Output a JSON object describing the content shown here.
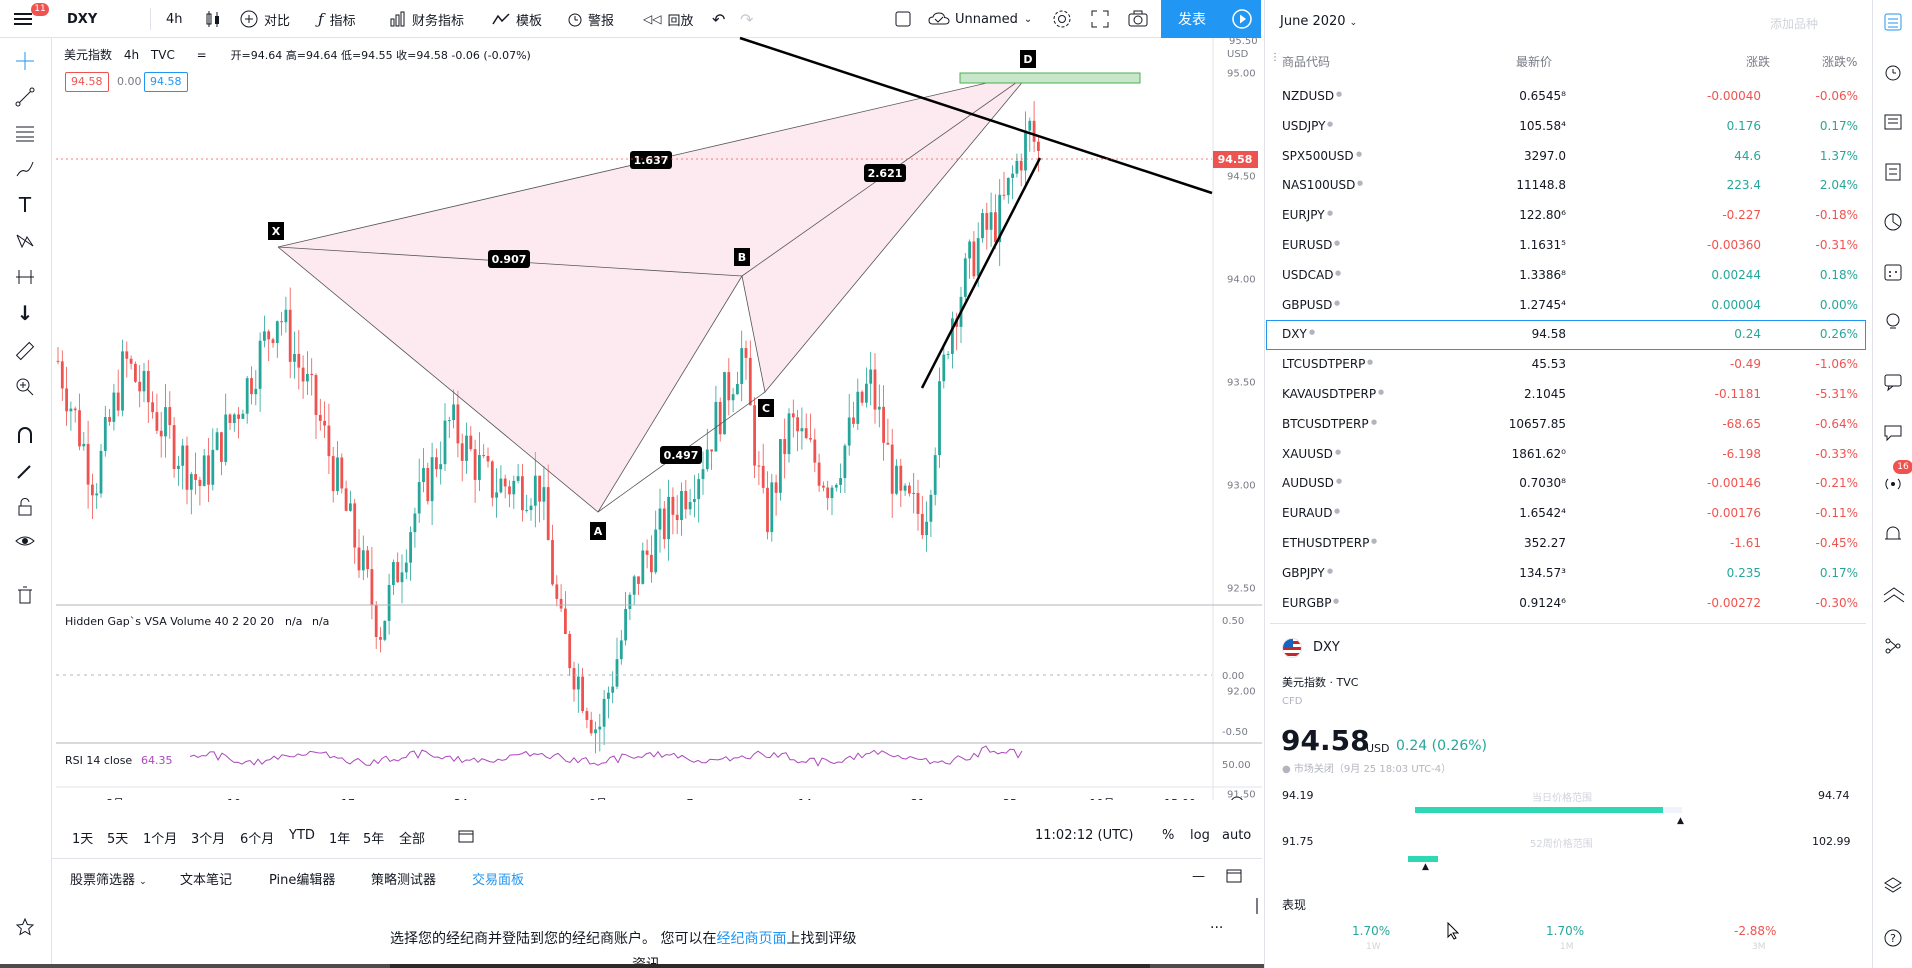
{
  "toolbar": {
    "menu_badge": "11",
    "symbol": "DXY",
    "interval": "4h",
    "compare": "对比",
    "indicators": "指标",
    "financials": "财务指标",
    "templates": "模板",
    "alerts": "警报",
    "replay": "回放",
    "layout_name": "Unnamed",
    "publish": "发表"
  },
  "legend": {
    "name": "美元指数",
    "interval": "4h",
    "exchange": "TVC",
    "ohlc": "开=94.64 高=94.64 低=94.55 收=94.58 -0.06 (-0.07%)",
    "bid": "94.58",
    "spread": "0.00",
    "ask": "94.58"
  },
  "price_axis": {
    "currency": "USD",
    "ticks": [
      "95.00",
      "94.50",
      "94.00",
      "93.50",
      "93.00",
      "92.50",
      "92.00",
      "91.50"
    ],
    "current_price": "94.58",
    "top_partial": "95.50"
  },
  "pattern": {
    "points": [
      "X",
      "A",
      "B",
      "C",
      "D"
    ],
    "ratios": {
      "xd": "1.637",
      "bd": "2.621",
      "xb": "0.907",
      "ac": "0.497"
    }
  },
  "vsa_pane": {
    "label": "Hidden Gap`s VSA Volume 40 2 20 20",
    "val1": "n/a",
    "val2": "n/a",
    "ticks": [
      "0.50",
      "0.00",
      "-0.50"
    ]
  },
  "rsi_pane": {
    "label": "RSI 14 close",
    "value": "64.35",
    "tick": "50.00",
    "color": "#ab47bc"
  },
  "time_axis": {
    "labels": [
      "8月",
      "10",
      "17",
      "24",
      "9月",
      "7",
      "14",
      "21",
      "25",
      "10月",
      "15:00"
    ]
  },
  "range_bar": {
    "ranges": [
      "1天",
      "5天",
      "1个月",
      "3个月",
      "6个月",
      "YTD",
      "1年",
      "5年",
      "全部"
    ],
    "clock": "11:02:12 (UTC)",
    "percent": "%",
    "log": "log",
    "auto": "auto"
  },
  "bottom_tabs": [
    "股票筛选器",
    "文本笔记",
    "Pine编辑器",
    "策略测试器",
    "交易面板"
  ],
  "broker_msg": {
    "before": "选择您的经纪商并登陆到您的经纪商账户。 您可以在",
    "link": "经纪商页面",
    "after": "上找到评级",
    "line2": "资讯"
  },
  "watchlist": {
    "title": "June 2020",
    "add": "添加品种",
    "headers": [
      "商品代码",
      "最新价",
      "涨跌",
      "涨跌%"
    ],
    "rows": [
      {
        "sym": "NZDUSD",
        "last": "0.6545⁸",
        "chg": "-0.00040",
        "pct": "-0.06%",
        "dir": "neg"
      },
      {
        "sym": "USDJPY",
        "last": "105.58⁴",
        "chg": "0.176",
        "pct": "0.17%",
        "dir": "pos"
      },
      {
        "sym": "SPX500USD",
        "last": "3297.0",
        "chg": "44.6",
        "pct": "1.37%",
        "dir": "pos"
      },
      {
        "sym": "NAS100USD",
        "last": "11148.8",
        "chg": "223.4",
        "pct": "2.04%",
        "dir": "pos"
      },
      {
        "sym": "EURJPY",
        "last": "122.80⁶",
        "chg": "-0.227",
        "pct": "-0.18%",
        "dir": "neg"
      },
      {
        "sym": "EURUSD",
        "last": "1.1631⁵",
        "chg": "-0.00360",
        "pct": "-0.31%",
        "dir": "neg"
      },
      {
        "sym": "USDCAD",
        "last": "1.3386⁸",
        "chg": "0.00244",
        "pct": "0.18%",
        "dir": "pos"
      },
      {
        "sym": "GBPUSD",
        "last": "1.2745⁴",
        "chg": "0.00004",
        "pct": "0.00%",
        "dir": "pos"
      },
      {
        "sym": "DXY",
        "last": "94.58",
        "chg": "0.24",
        "pct": "0.26%",
        "dir": "pos"
      },
      {
        "sym": "LTCUSDTPERP",
        "last": "45.53",
        "chg": "-0.49",
        "pct": "-1.06%",
        "dir": "neg"
      },
      {
        "sym": "KAVAUSDTPERP",
        "last": "2.1045",
        "chg": "-0.1181",
        "pct": "-5.31%",
        "dir": "neg"
      },
      {
        "sym": "BTCUSDTPERP",
        "last": "10657.85",
        "chg": "-68.65",
        "pct": "-0.64%",
        "dir": "neg"
      },
      {
        "sym": "XAUUSD",
        "last": "1861.62⁰",
        "chg": "-6.198",
        "pct": "-0.33%",
        "dir": "neg"
      },
      {
        "sym": "AUDUSD",
        "last": "0.7030⁸",
        "chg": "-0.00146",
        "pct": "-0.21%",
        "dir": "neg"
      },
      {
        "sym": "EURAUD",
        "last": "1.6542⁴",
        "chg": "-0.00176",
        "pct": "-0.11%",
        "dir": "neg"
      },
      {
        "sym": "ETHUSDTPERP",
        "last": "352.27",
        "chg": "-1.61",
        "pct": "-0.45%",
        "dir": "neg"
      },
      {
        "sym": "GBPJPY",
        "last": "134.57³",
        "chg": "0.235",
        "pct": "0.17%",
        "dir": "pos"
      },
      {
        "sym": "EURGBP",
        "last": "0.9124⁶",
        "chg": "-0.00272",
        "pct": "-0.30%",
        "dir": "neg"
      }
    ]
  },
  "details": {
    "symbol": "DXY",
    "name": "美元指数",
    "exchange": "TVC",
    "type": "CFD",
    "price": "94.58",
    "currency": "USD",
    "change": "0.24 (0.26%)",
    "status": "市场关闭（9月 25 18:03 UTC-4）",
    "day_low": "94.19",
    "day_high": "94.74",
    "day_range_label": "当日价格范围",
    "year_low": "91.75",
    "year_high": "102.99",
    "year_range_label": "52周价格范围",
    "day_range_fill": 0.93,
    "year_range_fill": 0.2,
    "performance_label": "表现",
    "perf": [
      {
        "value": "1.70%",
        "period": "1W",
        "dir": "pos"
      },
      {
        "value": "1.70%",
        "period": "1M",
        "dir": "pos"
      },
      {
        "value": "-2.88%",
        "period": "3M",
        "dir": "neg"
      }
    ]
  },
  "right_strip": {
    "ideas_badge": "16"
  },
  "colors": {
    "up": "#26a69a",
    "down": "#ef5350",
    "accent": "#2196f3",
    "pattern_fill": "#f8bbd0",
    "price_label": "#ef5350"
  }
}
